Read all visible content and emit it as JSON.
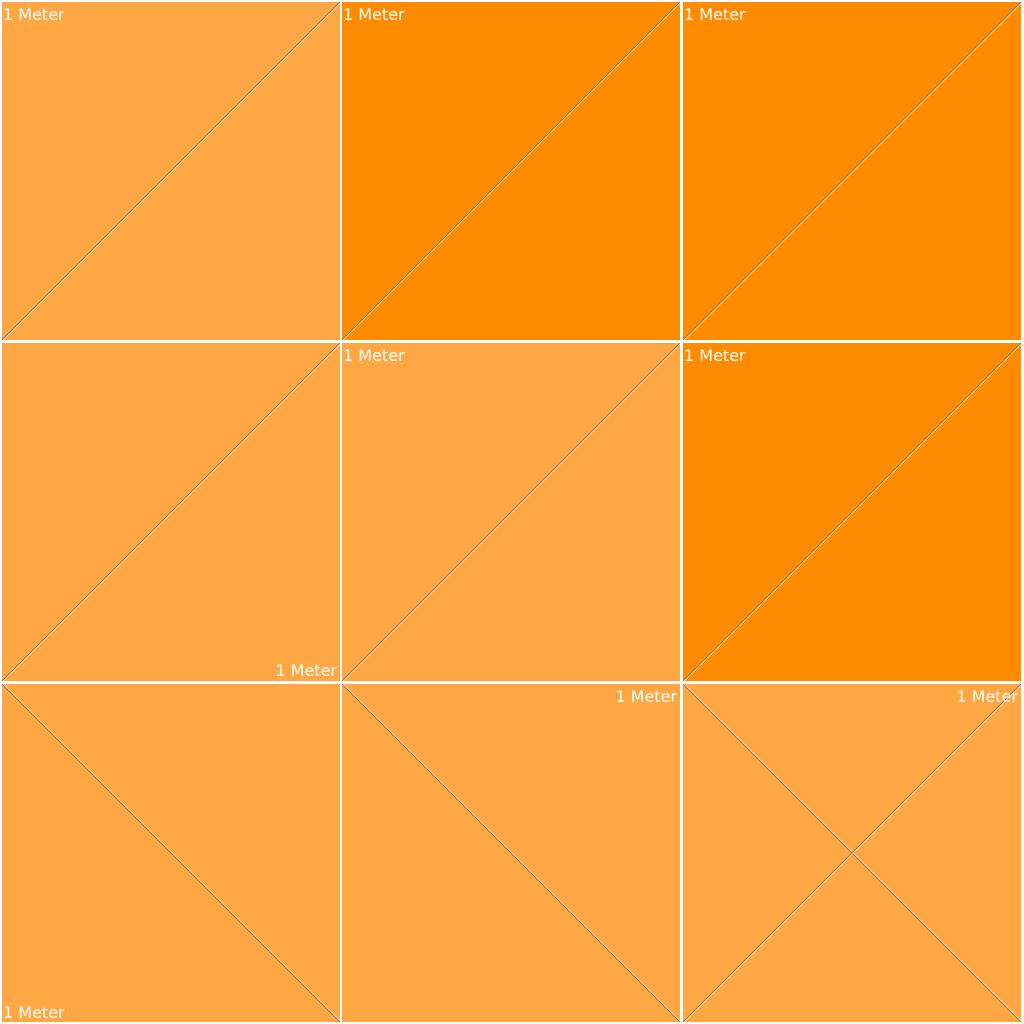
{
  "colors": {
    "light_orange": "#FFA742",
    "dark_orange": "#FF8C00",
    "grid_line": "#FFFFFF",
    "diagonal_dark": "#8A6A48",
    "diagonal_light": "#FFE9C8"
  },
  "tiles": [
    {
      "fill": "light",
      "diagonals": [
        "rising"
      ],
      "label": "1 Meter",
      "label_corner": "top-left"
    },
    {
      "fill": "dark",
      "diagonals": [
        "rising"
      ],
      "label": "1 Meter",
      "label_corner": "top-left"
    },
    {
      "fill": "dark",
      "diagonals": [
        "rising"
      ],
      "label": "1 Meter",
      "label_corner": "top-left"
    },
    {
      "fill": "light",
      "diagonals": [
        "rising"
      ],
      "label": "1 Meter",
      "label_corner": "bottom-right"
    },
    {
      "fill": "light",
      "diagonals": [
        "rising"
      ],
      "label": "1 Meter",
      "label_corner": "top-left"
    },
    {
      "fill": "dark",
      "diagonals": [
        "rising"
      ],
      "label": "1 Meter",
      "label_corner": "top-left"
    },
    {
      "fill": "light",
      "diagonals": [
        "falling"
      ],
      "label": "1 Meter",
      "label_corner": "bottom-left"
    },
    {
      "fill": "light",
      "diagonals": [
        "falling"
      ],
      "label": "1 Meter",
      "label_corner": "top-right"
    },
    {
      "fill": "light",
      "diagonals": [
        "falling",
        "rising"
      ],
      "label": "1 Meter",
      "label_corner": "top-right"
    }
  ]
}
